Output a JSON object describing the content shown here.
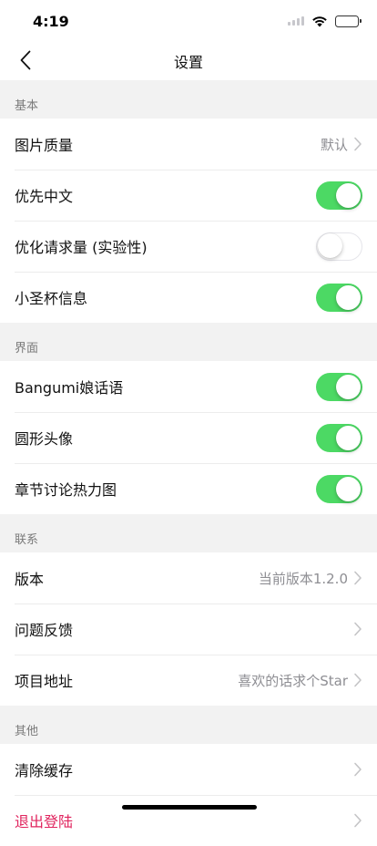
{
  "status_bar": {
    "time": "4:19"
  },
  "nav": {
    "title": "设置"
  },
  "sections": [
    {
      "header": "基本",
      "rows": [
        {
          "label": "图片质量",
          "type": "link",
          "value": "默认"
        },
        {
          "label": "优先中文",
          "type": "toggle",
          "on": true
        },
        {
          "label": "优化请求量 (实验性)",
          "type": "toggle",
          "on": false
        },
        {
          "label": "小圣杯信息",
          "type": "toggle",
          "on": true
        }
      ]
    },
    {
      "header": "界面",
      "rows": [
        {
          "label": "Bangumi娘话语",
          "type": "toggle",
          "on": true
        },
        {
          "label": "圆形头像",
          "type": "toggle",
          "on": true
        },
        {
          "label": "章节讨论热力图",
          "type": "toggle",
          "on": true
        }
      ]
    },
    {
      "header": "联系",
      "rows": [
        {
          "label": "版本",
          "type": "link",
          "value": "当前版本1.2.0"
        },
        {
          "label": "问题反馈",
          "type": "link",
          "value": ""
        },
        {
          "label": "项目地址",
          "type": "link",
          "value": "喜欢的话求个Star"
        }
      ]
    },
    {
      "header": "其他",
      "rows": [
        {
          "label": "清除缓存",
          "type": "link",
          "value": ""
        },
        {
          "label": "退出登陆",
          "type": "link",
          "value": "",
          "danger": true
        }
      ]
    }
  ],
  "colors": {
    "toggle_on": "#4cd964",
    "danger": "#e0245e",
    "secondary_text": "#8e8e93"
  },
  "icons": {
    "back": "chevron-left-icon",
    "disclosure": "chevron-right-icon",
    "signal": "signal-icon",
    "wifi": "wifi-icon",
    "battery": "battery-icon"
  }
}
